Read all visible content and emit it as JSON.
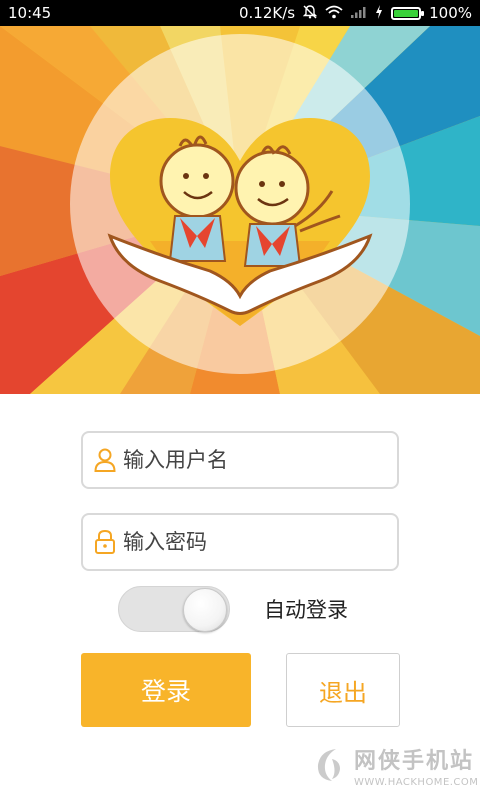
{
  "status_bar": {
    "time": "10:45",
    "network_speed": "0.12K/s",
    "battery_percent": "100%",
    "icons": [
      "mute-icon",
      "wifi-icon",
      "signal-icon",
      "charging-icon",
      "battery-icon"
    ]
  },
  "login_form": {
    "username_placeholder": "输入用户名",
    "password_placeholder": "输入密码",
    "auto_login_label": "自动登录",
    "auto_login_enabled": true,
    "login_button": "登录",
    "exit_button": "退出"
  },
  "watermark": {
    "name": "网侠手机站",
    "url": "WWW.HACKHOME.COM"
  },
  "colors": {
    "accent": "#f8b42a",
    "exit_text": "#f5a623",
    "battery_fill": "#3ad13a"
  }
}
